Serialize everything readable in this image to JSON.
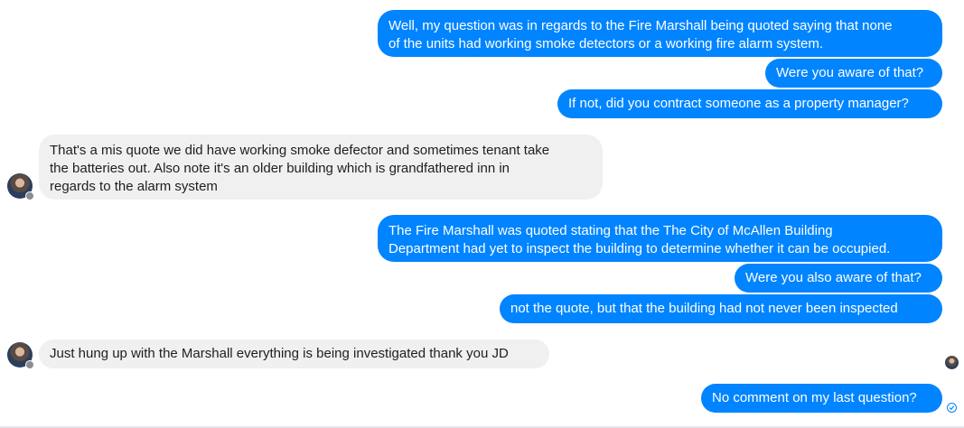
{
  "messages": [
    {
      "sender": "me",
      "text": "Well, my question was in regards to the Fire Marshall being quoted saying that none\nof the units had working smoke detectors or a working fire alarm system."
    },
    {
      "sender": "me",
      "text": "Were you aware of that?"
    },
    {
      "sender": "me",
      "text": "If not, did you contract someone as a property manager?"
    },
    {
      "sender": "other",
      "text": "That's a mis quote we did have working smoke defector and sometimes tenant take\nthe batteries out.  Also note it's an older building which is grandfathered inn in\nregards to the alarm system"
    },
    {
      "sender": "me",
      "text": "The Fire Marshall was quoted stating that the The City of McAllen Building\nDepartment had yet to inspect the building to determine whether it can be occupied."
    },
    {
      "sender": "me",
      "text": "Were you also aware of that?"
    },
    {
      "sender": "me",
      "text": "not the quote, but that the building had not never been inspected"
    },
    {
      "sender": "other",
      "text": "Just hung up with the Marshall everything is being investigated thank you JD"
    },
    {
      "sender": "me",
      "text": "No comment on my last question?"
    }
  ],
  "icons": {
    "contact_avatar": "profile-photo",
    "platform_badge": "facebook-badge",
    "read_receipt": "seen-avatar",
    "sent_status": "sent-check-icon"
  },
  "colors": {
    "outgoing_bubble": "#0084ff",
    "incoming_bubble": "#f1f0f0",
    "incoming_text": "#1c1e21",
    "outgoing_text": "#ffffff"
  }
}
